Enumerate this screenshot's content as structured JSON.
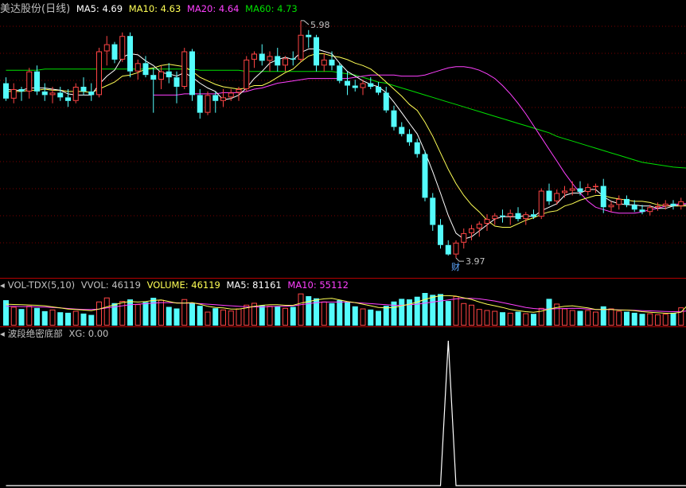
{
  "colors": {
    "up": "#ff4444",
    "down": "#54fcfc",
    "ma5": "#ffffff",
    "ma10": "#ffff55",
    "ma20": "#ff40ff",
    "ma60": "#00e000",
    "grid": "#7a0000",
    "separator": "#b30000",
    "label": "#c0c0c0"
  },
  "main": {
    "name": "美达股份(日线)",
    "ma5_label": "MA5: 4.69",
    "ma10_label": "MA10: 4.63",
    "ma20_label": "MA20: 4.64",
    "ma60_label": "MA60: 4.73",
    "high_mark": "5.98",
    "low_mark": "3.97",
    "event_tag": "财"
  },
  "volume": {
    "title": "VOL-TDX(5,10)",
    "vvol_label": "VVOL: 46119",
    "volume_label": "VOLUME: 46119",
    "ma5_label": "MA5: 81161",
    "ma10_label": "MA10: 55112"
  },
  "indicator": {
    "title": "波段绝密底部",
    "xg_label": "XG: 0.00"
  },
  "chart_data": [
    {
      "type": "candlestick",
      "title": "美达股份(日线)",
      "series": [
        {
          "name": "MA5",
          "last": 4.69
        },
        {
          "name": "MA10",
          "last": 4.63
        },
        {
          "name": "MA20",
          "last": 4.64
        },
        {
          "name": "MA60",
          "last": 4.73
        }
      ],
      "ohlc": [
        [
          5.45,
          5.5,
          5.3,
          5.32
        ],
        [
          5.32,
          5.45,
          5.28,
          5.4
        ],
        [
          5.4,
          5.42,
          5.3,
          5.38
        ],
        [
          5.38,
          5.58,
          5.32,
          5.55
        ],
        [
          5.55,
          5.6,
          5.35,
          5.38
        ],
        [
          5.38,
          5.45,
          5.3,
          5.35
        ],
        [
          5.35,
          5.42,
          5.28,
          5.37
        ],
        [
          5.37,
          5.42,
          5.3,
          5.33
        ],
        [
          5.33,
          5.4,
          5.25,
          5.3
        ],
        [
          5.3,
          5.45,
          5.28,
          5.42
        ],
        [
          5.42,
          5.5,
          5.35,
          5.38
        ],
        [
          5.38,
          5.45,
          5.3,
          5.35
        ],
        [
          5.35,
          5.75,
          5.33,
          5.72
        ],
        [
          5.72,
          5.85,
          5.6,
          5.78
        ],
        [
          5.78,
          5.8,
          5.62,
          5.65
        ],
        [
          5.65,
          5.88,
          5.63,
          5.85
        ],
        [
          5.85,
          5.88,
          5.5,
          5.55
        ],
        [
          5.55,
          5.65,
          5.48,
          5.62
        ],
        [
          5.62,
          5.68,
          5.5,
          5.52
        ],
        [
          5.52,
          5.58,
          5.2,
          5.48
        ],
        [
          5.48,
          5.6,
          5.4,
          5.55
        ],
        [
          5.55,
          5.62,
          5.45,
          5.5
        ],
        [
          5.5,
          5.55,
          5.28,
          5.42
        ],
        [
          5.42,
          5.75,
          5.4,
          5.72
        ],
        [
          5.72,
          5.74,
          5.3,
          5.35
        ],
        [
          5.35,
          5.4,
          5.15,
          5.2
        ],
        [
          5.2,
          5.38,
          5.18,
          5.35
        ],
        [
          5.35,
          5.38,
          5.2,
          5.3
        ],
        [
          5.3,
          5.4,
          5.25,
          5.33
        ],
        [
          5.33,
          5.4,
          5.3,
          5.37
        ],
        [
          5.37,
          5.42,
          5.3,
          5.4
        ],
        [
          5.4,
          5.68,
          5.38,
          5.65
        ],
        [
          5.65,
          5.72,
          5.58,
          5.7
        ],
        [
          5.7,
          5.78,
          5.6,
          5.64
        ],
        [
          5.64,
          5.72,
          5.55,
          5.68
        ],
        [
          5.68,
          5.75,
          5.55,
          5.6
        ],
        [
          5.6,
          5.68,
          5.55,
          5.66
        ],
        [
          5.66,
          5.72,
          5.6,
          5.65
        ],
        [
          5.65,
          5.98,
          5.63,
          5.86
        ],
        [
          5.86,
          5.9,
          5.75,
          5.84
        ],
        [
          5.84,
          5.86,
          5.55,
          5.6
        ],
        [
          5.6,
          5.7,
          5.55,
          5.65
        ],
        [
          5.65,
          5.72,
          5.56,
          5.6
        ],
        [
          5.6,
          5.62,
          5.45,
          5.47
        ],
        [
          5.47,
          5.55,
          5.35,
          5.43
        ],
        [
          5.43,
          5.48,
          5.38,
          5.41
        ],
        [
          5.41,
          5.48,
          5.35,
          5.45
        ],
        [
          5.45,
          5.5,
          5.4,
          5.42
        ],
        [
          5.42,
          5.46,
          5.35,
          5.37
        ],
        [
          5.37,
          5.42,
          5.2,
          5.22
        ],
        [
          5.22,
          5.26,
          5.05,
          5.08
        ],
        [
          5.08,
          5.12,
          5.0,
          5.02
        ],
        [
          5.02,
          5.06,
          4.92,
          4.95
        ],
        [
          4.95,
          4.98,
          4.82,
          4.85
        ],
        [
          4.85,
          4.88,
          4.45,
          4.48
        ],
        [
          4.48,
          4.52,
          4.2,
          4.25
        ],
        [
          4.25,
          4.3,
          4.05,
          4.08
        ],
        [
          4.08,
          4.12,
          3.99,
          4.0
        ],
        [
          4.0,
          4.12,
          3.97,
          4.1
        ],
        [
          4.1,
          4.22,
          4.05,
          4.18
        ],
        [
          4.18,
          4.25,
          4.12,
          4.22
        ],
        [
          4.22,
          4.28,
          4.15,
          4.26
        ],
        [
          4.26,
          4.34,
          4.2,
          4.3
        ],
        [
          4.3,
          4.35,
          4.25,
          4.33
        ],
        [
          4.33,
          4.38,
          4.27,
          4.32
        ],
        [
          4.32,
          4.38,
          4.25,
          4.35
        ],
        [
          4.35,
          4.4,
          4.28,
          4.3
        ],
        [
          4.3,
          4.36,
          4.25,
          4.34
        ],
        [
          4.34,
          4.38,
          4.3,
          4.32
        ],
        [
          4.32,
          4.56,
          4.3,
          4.54
        ],
        [
          4.54,
          4.6,
          4.42,
          4.45
        ],
        [
          4.45,
          4.55,
          4.42,
          4.52
        ],
        [
          4.52,
          4.58,
          4.48,
          4.54
        ],
        [
          4.54,
          4.62,
          4.5,
          4.56
        ],
        [
          4.56,
          4.62,
          4.5,
          4.53
        ],
        [
          4.53,
          4.6,
          4.5,
          4.57
        ],
        [
          4.57,
          4.6,
          4.52,
          4.58
        ],
        [
          4.58,
          4.64,
          4.35,
          4.4
        ],
        [
          4.4,
          4.45,
          4.36,
          4.42
        ],
        [
          4.42,
          4.5,
          4.38,
          4.47
        ],
        [
          4.47,
          4.5,
          4.4,
          4.42
        ],
        [
          4.42,
          4.46,
          4.36,
          4.38
        ],
        [
          4.38,
          4.42,
          4.34,
          4.36
        ],
        [
          4.36,
          4.42,
          4.33,
          4.4
        ],
        [
          4.4,
          4.44,
          4.37,
          4.41
        ],
        [
          4.41,
          4.46,
          4.38,
          4.43
        ],
        [
          4.43,
          4.46,
          4.38,
          4.41
        ],
        [
          4.41,
          4.48,
          4.38,
          4.45
        ],
        [
          4.45,
          4.48,
          4.4,
          4.42
        ]
      ],
      "ma5": [
        5.4,
        5.39,
        5.39,
        5.41,
        5.41,
        5.41,
        5.4,
        5.39,
        5.36,
        5.35,
        5.35,
        5.35,
        5.44,
        5.51,
        5.56,
        5.67,
        5.7,
        5.69,
        5.64,
        5.6,
        5.54,
        5.53,
        5.51,
        5.54,
        5.5,
        5.45,
        5.41,
        5.38,
        5.31,
        5.32,
        5.35,
        5.41,
        5.49,
        5.55,
        5.62,
        5.65,
        5.67,
        5.65,
        5.71,
        5.74,
        5.74,
        5.72,
        5.7,
        5.62,
        5.55,
        5.51,
        5.47,
        5.44,
        5.42,
        5.37,
        5.29,
        5.2,
        5.11,
        5.02,
        4.87,
        4.7,
        4.52,
        4.33,
        4.18,
        4.13,
        4.15,
        4.2,
        4.25,
        4.3,
        4.32,
        4.32,
        4.32,
        4.33,
        4.32,
        4.37,
        4.4,
        4.43,
        4.5,
        4.52,
        4.52,
        4.55,
        4.55,
        4.49,
        4.45,
        4.43,
        4.42,
        4.42,
        4.41,
        4.41,
        4.39,
        4.39,
        4.41,
        4.42,
        4.42
      ],
      "ma10": [
        5.38,
        5.38,
        5.38,
        5.39,
        5.39,
        5.4,
        5.39,
        5.39,
        5.38,
        5.38,
        5.38,
        5.37,
        5.4,
        5.43,
        5.46,
        5.51,
        5.52,
        5.54,
        5.57,
        5.58,
        5.6,
        5.61,
        5.6,
        5.59,
        5.55,
        5.5,
        5.47,
        5.44,
        5.42,
        5.41,
        5.4,
        5.41,
        5.43,
        5.43,
        5.46,
        5.5,
        5.54,
        5.57,
        5.63,
        5.68,
        5.7,
        5.7,
        5.68,
        5.67,
        5.65,
        5.62,
        5.6,
        5.57,
        5.52,
        5.46,
        5.4,
        5.34,
        5.27,
        5.22,
        5.12,
        5.0,
        4.86,
        4.72,
        4.6,
        4.5,
        4.42,
        4.36,
        4.29,
        4.24,
        4.23,
        4.23,
        4.26,
        4.29,
        4.31,
        4.34,
        4.36,
        4.37,
        4.41,
        4.43,
        4.46,
        4.48,
        4.5,
        4.5,
        4.48,
        4.47,
        4.46,
        4.45,
        4.45,
        4.44,
        4.42,
        4.41,
        4.41,
        4.41,
        4.41
      ],
      "ma20": [
        5.35,
        5.35,
        5.35,
        5.35,
        5.36,
        5.36,
        5.36,
        5.36,
        5.36,
        5.37,
        5.37,
        5.37,
        5.38,
        5.4,
        5.41,
        5.43,
        5.45,
        5.46,
        5.47,
        5.48,
        5.49,
        5.49,
        5.49,
        5.49,
        5.49,
        5.49,
        5.5,
        5.51,
        5.52,
        5.52,
        5.52,
        5.52,
        5.51,
        5.51,
        5.51,
        5.52,
        5.54,
        5.56,
        5.58,
        5.59,
        5.59,
        5.58,
        5.56,
        5.53,
        5.49,
        5.43,
        5.36,
        5.28,
        5.19,
        5.09,
        4.99,
        4.89,
        4.79,
        4.69,
        4.6,
        4.52,
        4.45,
        4.4,
        4.38,
        4.36,
        4.35,
        4.35,
        4.35,
        4.36,
        4.38,
        4.39,
        4.41,
        4.42,
        4.43,
        4.43
      ],
      "ma60": [
        5.56,
        5.56,
        5.56,
        5.56,
        5.56,
        5.57,
        5.57,
        5.57,
        5.57,
        5.57,
        5.57,
        5.57,
        5.57,
        5.57,
        5.57,
        5.57,
        5.57,
        5.57,
        5.57,
        5.57,
        5.57,
        5.57,
        5.57,
        5.57,
        5.57,
        5.56,
        5.56,
        5.56,
        5.56,
        5.56,
        5.56,
        5.55,
        5.55,
        5.55,
        5.55,
        5.55,
        5.55,
        5.55,
        5.55,
        5.55,
        5.55,
        5.55,
        5.55,
        5.54,
        5.53,
        5.52,
        5.5,
        5.48,
        5.46,
        5.45,
        5.43,
        5.41,
        5.39,
        5.37,
        5.35,
        5.33,
        5.31,
        5.29,
        5.27,
        5.25,
        5.23,
        5.21,
        5.19,
        5.17,
        5.15,
        5.13,
        5.11,
        5.09,
        5.07,
        5.05,
        5.03,
        5.0,
        4.98,
        4.96,
        4.94,
        4.92,
        4.9,
        4.88,
        4.86,
        4.84,
        4.82,
        4.8,
        4.78,
        4.77,
        4.76,
        4.75,
        4.74,
        4.735,
        4.73
      ]
    },
    {
      "type": "bar",
      "title": "VOL-TDX(5,10)",
      "series": [
        {
          "name": "VOLUME",
          "last": 46119
        },
        {
          "name": "MA5",
          "last": 81161
        },
        {
          "name": "MA10",
          "last": 55112
        }
      ],
      "values": [
        95000,
        70000,
        62000,
        74000,
        66000,
        54000,
        60000,
        50000,
        48000,
        55000,
        45000,
        40000,
        90000,
        105000,
        84000,
        92000,
        98000,
        80000,
        88000,
        104000,
        96000,
        70000,
        64000,
        99000,
        85000,
        74000,
        52000,
        65000,
        60000,
        56000,
        64000,
        78000,
        85000,
        76000,
        74000,
        72000,
        66000,
        70000,
        120000,
        110000,
        102000,
        90000,
        84000,
        95000,
        88000,
        72000,
        64000,
        60000,
        55000,
        74000,
        90000,
        100000,
        98000,
        108000,
        122000,
        115000,
        118000,
        92000,
        110000,
        84000,
        78000,
        62000,
        58000,
        55000,
        50000,
        48000,
        52000,
        46000,
        44000,
        66000,
        100000,
        82000,
        64000,
        58000,
        55000,
        58000,
        52000,
        72000,
        64000,
        55000,
        52000,
        48000,
        44000,
        46000,
        42000,
        44000,
        48000,
        68000,
        46119
      ],
      "ma5": [
        80000,
        79000,
        78000,
        77000,
        76000,
        74000,
        70000,
        66000,
        62000,
        60000,
        58000,
        56000,
        62000,
        70000,
        78000,
        86000,
        90000,
        88000,
        90000,
        94000,
        96000,
        90000,
        84000,
        84000,
        86000,
        80000,
        72000,
        68000,
        66000,
        62000,
        62000,
        66000,
        72000,
        76000,
        78000,
        78000,
        76000,
        76000,
        84000,
        90000,
        96000,
        100000,
        102000,
        96000,
        90000,
        86000,
        80000,
        74000,
        68000,
        66000,
        68000,
        74000,
        80000,
        88000,
        98000,
        106000,
        112000,
        112000,
        110000,
        104000,
        98000,
        88000,
        80000,
        74000,
        68000,
        60000,
        56000,
        52000,
        50000,
        54000,
        62000,
        68000,
        72000,
        74000,
        70000,
        66000,
        60000,
        60000,
        60000,
        58000,
        58000,
        56000,
        52000,
        50000,
        48000,
        46000,
        46000,
        50000,
        81161
      ],
      "ma10": [
        72000,
        72000,
        71000,
        71000,
        70000,
        69000,
        68000,
        66000,
        64000,
        62000,
        60000,
        60000,
        62000,
        66000,
        70000,
        74000,
        78000,
        80000,
        82000,
        84000,
        86000,
        86000,
        85000,
        84000,
        84000,
        82000,
        80000,
        78000,
        76000,
        74000,
        72000,
        70000,
        70000,
        70000,
        71000,
        72000,
        72000,
        74000,
        78000,
        82000,
        86000,
        88000,
        88000,
        88000,
        88000,
        86000,
        84000,
        82000,
        80000,
        78000,
        76000,
        76000,
        78000,
        80000,
        84000,
        88000,
        92000,
        96000,
        100000,
        102000,
        102000,
        100000,
        96000,
        92000,
        86000,
        80000,
        74000,
        68000,
        64000,
        62000,
        62000,
        63000,
        64000,
        65000,
        64000,
        62000,
        60000,
        60000,
        60000,
        59000,
        58000,
        57000,
        56000,
        55000,
        54000,
        53000,
        52000,
        53000,
        55112
      ]
    },
    {
      "type": "line",
      "title": "波段绝密底部",
      "series": [
        {
          "name": "XG",
          "last": 0.0
        }
      ],
      "values": [
        0,
        0,
        0,
        0,
        0,
        0,
        0,
        0,
        0,
        0,
        0,
        0,
        0,
        0,
        0,
        0,
        0,
        0,
        0,
        0,
        0,
        0,
        0,
        0,
        0,
        0,
        0,
        0,
        0,
        0,
        0,
        0,
        0,
        0,
        0,
        0,
        0,
        0,
        0,
        0,
        0,
        0,
        0,
        0,
        0,
        0,
        0,
        0,
        0,
        0,
        0,
        0,
        0,
        0,
        0,
        0,
        0,
        1,
        0,
        0,
        0,
        0,
        0,
        0,
        0,
        0,
        0,
        0,
        0,
        0,
        0,
        0,
        0,
        0,
        0,
        0,
        0,
        0,
        0,
        0,
        0,
        0,
        0,
        0,
        0,
        0,
        0,
        0,
        0
      ]
    }
  ]
}
